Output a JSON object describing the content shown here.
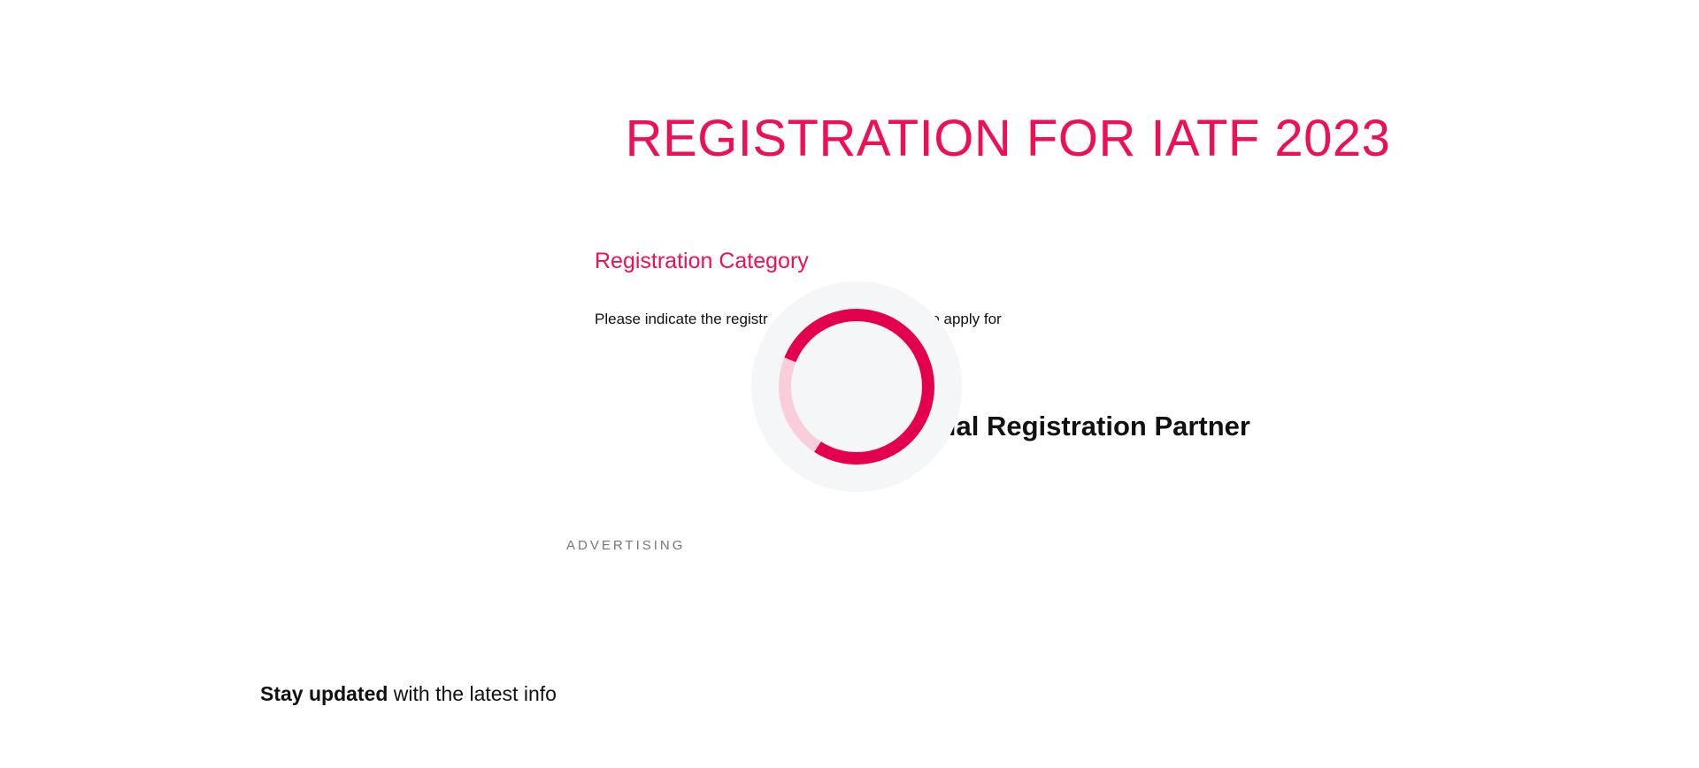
{
  "page": {
    "title": "REGISTRATION FOR IATF 2023"
  },
  "registration": {
    "section_title": "Registration Category",
    "instructions_visible_left": "Please indicate the registr",
    "instructions_visible_right": "to apply for"
  },
  "partner": {
    "heading_visible": "cial Registration Partner"
  },
  "advertising": {
    "label": "ADVERTISING"
  },
  "newsletter": {
    "lead_bold": "Stay updated",
    "lead_rest": " with the latest info"
  },
  "loading_spinner": {
    "icon": "loading-spinner-icon",
    "accent_color": "#e5004d",
    "track_color": "#f9cdd9",
    "background_color": "#f5f6f8",
    "progress_fraction": 0.78
  },
  "colors": {
    "brand": "#ee0f55",
    "text": "#111111",
    "muted": "#777777",
    "background": "#ffffff"
  }
}
